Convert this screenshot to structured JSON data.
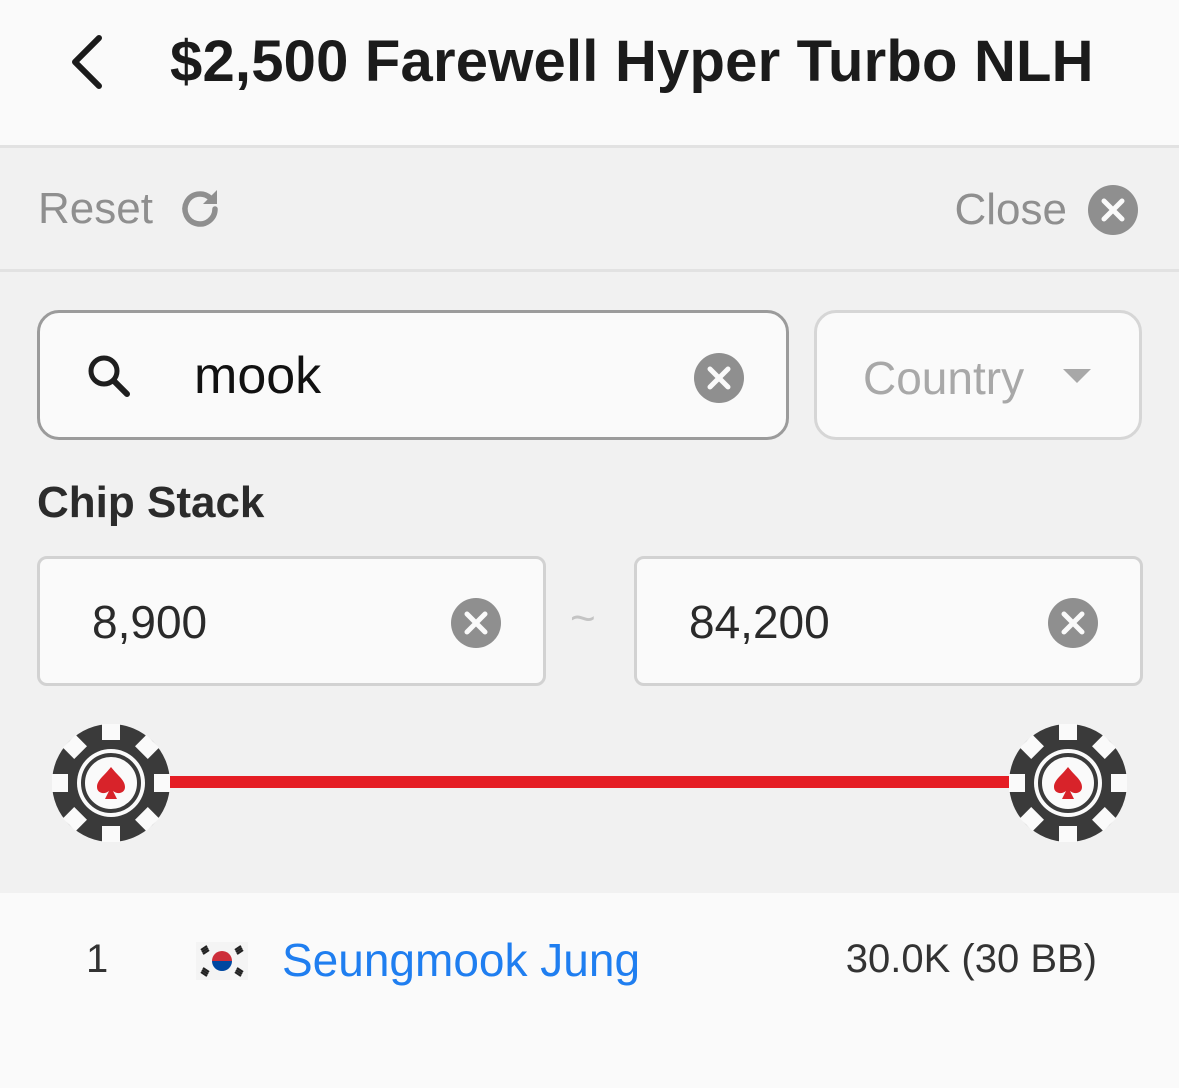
{
  "header": {
    "title": "$2,500 Farewell Hyper Turbo NLH",
    "back_icon": "chevron-left-icon"
  },
  "toolbar": {
    "reset_label": "Reset",
    "reset_icon": "refresh-icon",
    "close_label": "Close",
    "close_icon": "close-circle-icon"
  },
  "search": {
    "value": "mook",
    "icon": "search-icon"
  },
  "country": {
    "placeholder": "Country"
  },
  "chip_stack": {
    "label": "Chip Stack",
    "min_value": "8,900",
    "max_value": "84,200",
    "separator": "~",
    "slider_range_fraction": [
      0.0,
      1.0
    ]
  },
  "results": [
    {
      "rank": "1",
      "country_flag": "south-korea-flag-icon",
      "name": "Seungmook Jung",
      "stack": "30.0K (30 BB)"
    }
  ],
  "colors": {
    "accent": "#e51d24",
    "link": "#1f7ef0",
    "muted": "#8f8f8f"
  }
}
